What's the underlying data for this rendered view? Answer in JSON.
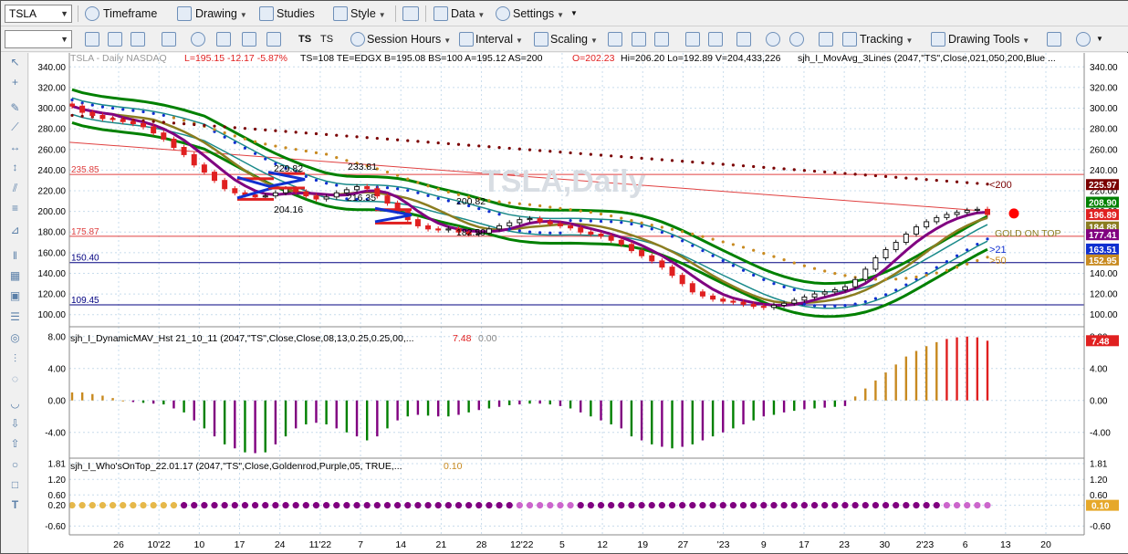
{
  "toolbar1": {
    "symbol": "TSLA",
    "timeframe": "Timeframe",
    "drawing": "Drawing",
    "studies": "Studies",
    "style": "Style",
    "data": "Data",
    "settings": "Settings"
  },
  "toolbar2": {
    "combo_value": "",
    "session_hours": "Session Hours",
    "interval": "Interval",
    "scaling": "Scaling",
    "tracking": "Tracking",
    "drawing_tools": "Drawing Tools"
  },
  "colors": {
    "up": "#1a1a1a",
    "down": "#e02020",
    "green": "#008000",
    "teal": "#1a8a8a",
    "purple": "#800080",
    "olive": "#8b7d20",
    "blue": "#1030d0",
    "darkred": "#7a0000",
    "orange": "#c88a20",
    "hline_red": "#e04040",
    "hline_blue": "#000080",
    "grid": "#c8dcec"
  },
  "chart_data": [
    {
      "type": "line",
      "panel": "price",
      "header": {
        "symbol_text": "TSLA - Daily  NASDAQ",
        "stats_red": "L=195.15  -12.17  -5.87%",
        "stats_black": "TS=108  TE=EDGX  B=195.08  BS=100  A=195.12  AS=200",
        "ohlc_red": "O=202.23",
        "ohlc_black": "Hi=206.20  Lo=192.89  V=204,433,226",
        "study": "sjh_I_MovAvg_3Lines (2047,\"TS\",Close,021,050,200,Blue ..."
      },
      "watermark": "TSLA,Daily",
      "ylim": [
        90,
        350
      ],
      "yticks": [
        "340.00",
        "320.00",
        "300.00",
        "280.00",
        "260.00",
        "240.00",
        "220.00",
        "200.00",
        "180.00",
        "160.00",
        "140.00",
        "120.00",
        "100.00"
      ],
      "xticks": [
        "26",
        "10'22",
        "10",
        "17",
        "24",
        "11'22",
        "7",
        "14",
        "21",
        "28",
        "12'22",
        "5",
        "12",
        "19",
        "27",
        "'23",
        "9",
        "17",
        "23",
        "30",
        "2'23",
        "6",
        "13",
        "20"
      ],
      "last_tag_red": "<200",
      "gold_on_top": "GOLD ON TOP",
      "ma21_tag": ">21",
      "ma50_tag": ">50",
      "hlines": [
        {
          "label": "235.85",
          "value": 235.85
        },
        {
          "label": "175.87",
          "value": 175.87
        },
        {
          "label": "150.40",
          "value": 150.4
        },
        {
          "label": "109.45",
          "value": 109.45
        }
      ],
      "annotations": [
        {
          "text": "229.82",
          "x": "Nov 01",
          "y": 229.82
        },
        {
          "text": "233.81",
          "x": "Nov 07",
          "y": 233.81
        },
        {
          "text": "204.16",
          "x": "Oct 24",
          "y": 204.16
        },
        {
          "text": "216.35",
          "x": "Nov 07",
          "y": 216.35
        },
        {
          "text": "200.82",
          "x": "Nov 29",
          "y": 200.82
        },
        {
          "text": "182.59",
          "x": "Nov 29",
          "y": 182.59
        }
      ],
      "right_tags": [
        {
          "text": "225.97",
          "value": 225.97,
          "color": "#7a0000"
        },
        {
          "text": "208.90",
          "value": 208.9,
          "color": "#008000"
        },
        {
          "text": "196.89",
          "value": 196.89,
          "color": "#e02020"
        },
        {
          "text": "184.88",
          "value": 184.88,
          "color": "#8b7d20"
        },
        {
          "text": "177.41",
          "value": 177.41,
          "color": "#800080"
        },
        {
          "text": "163.51",
          "value": 163.51,
          "color": "#1030d0"
        },
        {
          "text": "152.95",
          "value": 152.95,
          "color": "#c88a20"
        }
      ],
      "series": [
        {
          "name": "Close",
          "values": [
            302,
            296,
            293,
            290,
            289,
            287,
            285,
            282,
            276,
            270,
            262,
            255,
            245,
            238,
            230,
            222,
            218,
            216,
            214,
            215,
            218,
            222,
            219,
            215,
            212,
            214,
            218,
            221,
            224,
            222,
            215,
            208,
            200,
            192,
            186,
            183,
            182,
            183,
            180,
            178,
            179,
            183,
            186,
            189,
            192,
            193,
            190,
            188,
            186,
            184,
            180,
            178,
            176,
            172,
            168,
            162,
            157,
            152,
            146,
            138,
            130,
            122,
            118,
            115,
            113,
            112,
            110,
            108,
            107,
            109,
            111,
            114,
            117,
            120,
            122,
            124,
            127,
            134,
            144,
            155,
            163,
            170,
            178,
            185,
            190,
            194,
            197,
            199,
            201,
            202,
            197
          ]
        }
      ]
    },
    {
      "type": "bar",
      "panel": "dynamic_mav",
      "title": "sjh_I_DynamicMAV_Hst 21_10_11 (2047,\"TS\",Close,Close,08,13,0.25,0.25,00,...",
      "last_red": "7.48",
      "last_gray": "0.00",
      "right_tag": "7.48",
      "ylim": [
        -7,
        9
      ],
      "yticks": [
        "8.00",
        "4.00",
        "0.00",
        "-4.00"
      ],
      "values": [
        1,
        1,
        0.8,
        0.6,
        0.3,
        0,
        -0.2,
        -0.3,
        -0.4,
        -0.5,
        -1,
        -1.5,
        -2.5,
        -3.5,
        -4.5,
        -5.5,
        -6,
        -6.5,
        -6.6,
        -6.5,
        -5.5,
        -4.5,
        -3.5,
        -3,
        -2.8,
        -3,
        -3.5,
        -4,
        -4.5,
        -5,
        -4.5,
        -3.5,
        -2.5,
        -2,
        -1.8,
        -1.9,
        -2,
        -2,
        -1.8,
        -1.5,
        -1.2,
        -1,
        -0.8,
        -0.6,
        -0.5,
        -0.4,
        -0.4,
        -0.5,
        -0.7,
        -1,
        -1.5,
        -2,
        -2.5,
        -3,
        -3.5,
        -4.5,
        -5,
        -5.5,
        -5.8,
        -6,
        -5.8,
        -5.5,
        -5,
        -4.5,
        -4,
        -3.5,
        -3,
        -2.5,
        -2,
        -1.8,
        -1.5,
        -1.3,
        -1.1,
        -1,
        -0.9,
        -0.8,
        -0.7,
        0.5,
        1.5,
        2.5,
        3.5,
        4.5,
        5.5,
        6.2,
        6.8,
        7.3,
        7.7,
        7.9,
        8,
        7.9,
        7.48
      ]
    },
    {
      "type": "scatter",
      "panel": "whos_on_top",
      "title": "sjh_I_Who'sOnTop_22.01.17 (2047,\"TS\",Close,Goldenrod,Purple,05, TRUE,...",
      "last_value": "0.10",
      "right_tag": "0.10",
      "ylim": [
        -0.8,
        1.95
      ],
      "yticks": [
        "1.81",
        "1.20",
        "0.60",
        "0.20",
        "-0.60"
      ],
      "values": "0.20 all bars",
      "colors_sequence": "gold 1-11, purple 12-44, violet 45-50, purple 51-86, violet 87-94, purple 95-100, gold 101-end"
    }
  ]
}
